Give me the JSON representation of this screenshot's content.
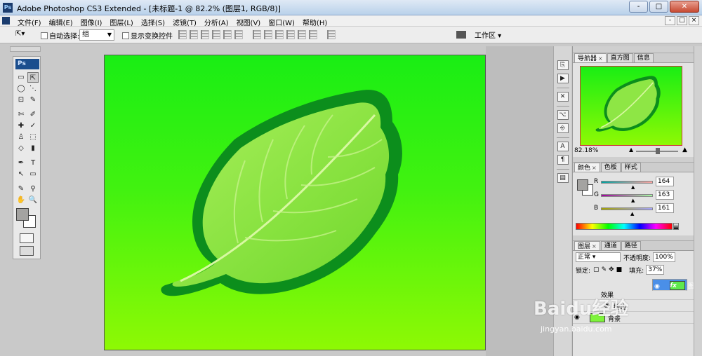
{
  "window": {
    "title": "Adobe Photoshop CS3 Extended - [未标题-1 @ 82.2% (图层1, RGB/8)]",
    "controls": [
      "-",
      "□",
      "✕"
    ]
  },
  "menu": [
    "文件(F)",
    "编辑(E)",
    "图像(I)",
    "图层(L)",
    "选择(S)",
    "滤镜(T)",
    "分析(A)",
    "视图(V)",
    "窗口(W)",
    "帮助(H)"
  ],
  "options": {
    "auto_select_label": "自动选择:",
    "auto_select_value": "组",
    "show_transform_label": "显示变换控件",
    "workspace_label": "工作区"
  },
  "tools": {
    "logo": "Ps",
    "items": [
      "▭",
      "⇱",
      "◯",
      "⋱",
      "⊡",
      "✎",
      "✄",
      "✐",
      "✚",
      "✓",
      "♙",
      "⬚",
      "◇",
      "▮",
      "◆",
      "●",
      "✒",
      "T",
      "↖",
      "▭",
      "✎",
      "⚲",
      "✋",
      "🔍"
    ]
  },
  "navigator": {
    "tabs": [
      "导航器",
      "直方图",
      "信息"
    ],
    "zoom": "82.18%"
  },
  "color": {
    "tabs": [
      "颜色",
      "色板",
      "样式"
    ],
    "r_label": "R",
    "r_value": "164",
    "g_label": "G",
    "g_value": "163",
    "b_label": "B",
    "b_value": "161",
    "foreground": "#a4a3a1"
  },
  "layers": {
    "tabs": [
      "图层",
      "通道",
      "路径"
    ],
    "blend_mode": "正常",
    "opacity_label": "不透明度:",
    "opacity_value": "100%",
    "lock_label": "锁定:",
    "fill_label": "填充:",
    "fill_value": "37%",
    "rows": [
      {
        "name": "图层1",
        "fx": "fx",
        "selected": true
      },
      {
        "name": "效果",
        "fx": "",
        "selected": false
      },
      {
        "name": "描边",
        "fx": "",
        "selected": false
      },
      {
        "name": "背景",
        "fx": "",
        "selected": false
      }
    ]
  },
  "watermark": {
    "main": "Baidu经验",
    "sub": "jingyan.baidu.com"
  },
  "colors": {
    "canvas_top": "#19ee14",
    "canvas_bottom": "#8ef904",
    "leaf_outline": "#0c8e1c",
    "leaf_fill": "#86e43e",
    "selection": "#4a8fe8"
  }
}
